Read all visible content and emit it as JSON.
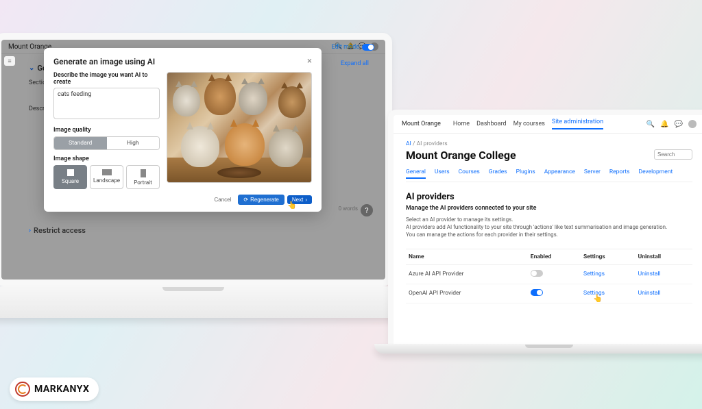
{
  "logo": {
    "text": "MARKANYX"
  },
  "left": {
    "site_name": "Mount Orange",
    "edit_mode": "Edit mode",
    "expand_all": "Expand all",
    "general_heading": "General",
    "general_prefix": "Ge",
    "section_label": "Section",
    "description_label": "Description",
    "word_counter": "0 words",
    "restrict_heading": "Restrict access",
    "modal": {
      "title": "Generate an image using AI",
      "describe_label": "Describe the image you want AI to create",
      "prompt_value": "cats feeding",
      "quality_label": "Image quality",
      "quality_options": {
        "standard": "Standard",
        "high": "High"
      },
      "shape_label": "Image shape",
      "shape_options": {
        "square": "Square",
        "landscape": "Landscape",
        "portrait": "Portrait"
      },
      "cancel": "Cancel",
      "regenerate": "Regenerate",
      "next": "Next"
    }
  },
  "right": {
    "site_name": "Mount Orange",
    "nav": {
      "home": "Home",
      "dashboard": "Dashboard",
      "mycourses": "My courses",
      "siteadmin": "Site administration"
    },
    "crumbs": {
      "ai": "AI",
      "sep": " / ",
      "providers": "AI providers"
    },
    "page_title": "Mount Orange College",
    "search_placeholder": "Search",
    "subtabs": {
      "general": "General",
      "users": "Users",
      "courses": "Courses",
      "grades": "Grades",
      "plugins": "Plugins",
      "appearance": "Appearance",
      "server": "Server",
      "reports": "Reports",
      "development": "Development"
    },
    "section_title": "AI providers",
    "section_subtitle": "Manage the AI providers connected to your site",
    "desc_line1": "Select an AI provider to manage its settings.",
    "desc_line2": "AI providers add AI functionality to your site through 'actions' like text summarisation and image generation.",
    "desc_line3": "You can manage the actions for each provider in their settings.",
    "table": {
      "th_name": "Name",
      "th_enabled": "Enabled",
      "th_settings": "Settings",
      "th_uninstall": "Uninstall",
      "rows": [
        {
          "name": "Azure AI API Provider",
          "enabled": false,
          "settings": "Settings",
          "uninstall": "Uninstall"
        },
        {
          "name": "OpenAI API Provider",
          "enabled": true,
          "settings": "Settings",
          "uninstall": "Uninstall"
        }
      ]
    }
  }
}
